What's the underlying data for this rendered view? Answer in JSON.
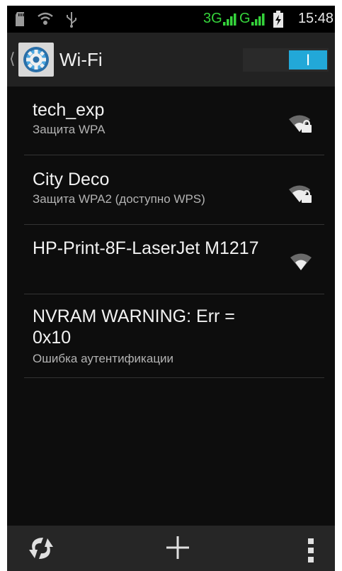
{
  "status_bar": {
    "network_3g": "3G",
    "network_g": "G",
    "time": "15:48"
  },
  "action_bar": {
    "title": "Wi-Fi",
    "toggle_state": "I"
  },
  "networks": [
    {
      "ssid": "tech_exp",
      "status": "Защита WPA",
      "signal_icon": "wifi-locked-icon"
    },
    {
      "ssid": "City Deco",
      "status": "Защита WPA2 (доступно WPS)",
      "signal_icon": "wifi-locked-icon"
    },
    {
      "ssid": "HP-Print-8F-LaserJet M1217",
      "status": "",
      "signal_icon": "wifi-icon"
    },
    {
      "ssid": "NVRAM WARNING: Err = 0x10",
      "status": "Ошибка аутентификации",
      "signal_icon": ""
    }
  ],
  "bottom_bar": {
    "icons": [
      "wps-icon",
      "add-network-icon",
      "overflow-menu-icon"
    ]
  },
  "colors": {
    "accent": "#22a8d8",
    "background": "#0d0d0d",
    "network_indicator": "#35d33b"
  }
}
